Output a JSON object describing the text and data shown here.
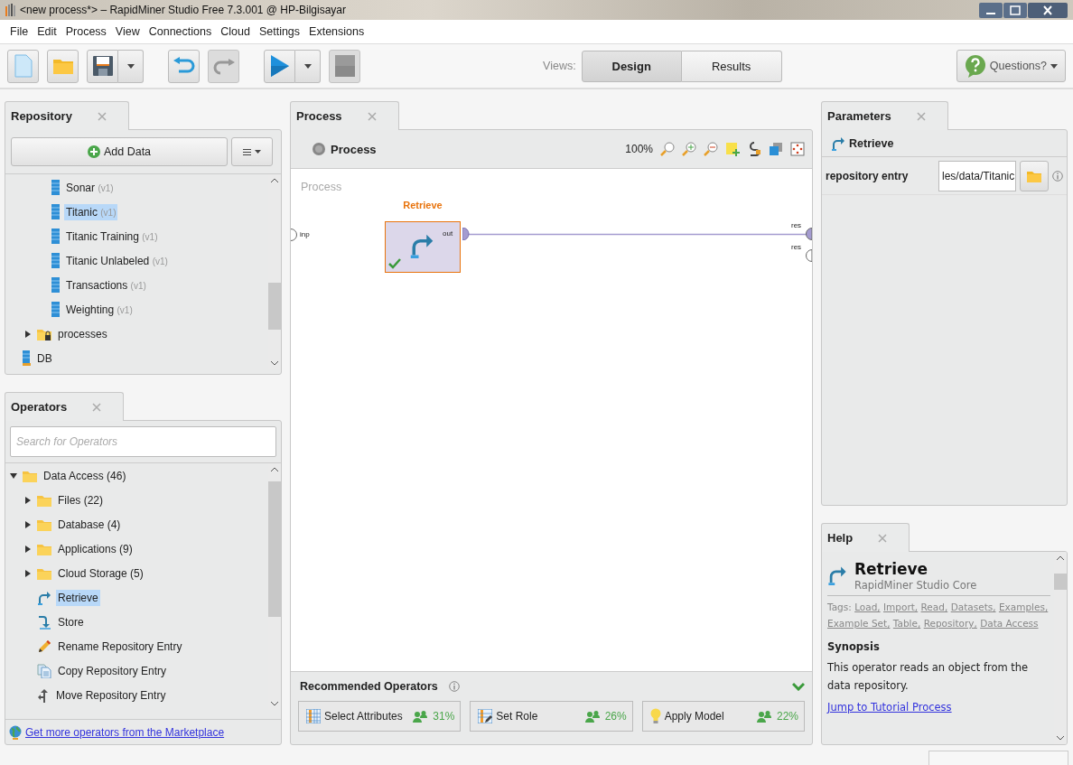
{
  "window": {
    "title": "<new process*> – RapidMiner Studio Free 7.3.001 @ HP-Bilgisayar"
  },
  "menu": [
    "File",
    "Edit",
    "Process",
    "View",
    "Connections",
    "Cloud",
    "Settings",
    "Extensions"
  ],
  "toolbar": {
    "buttons": [
      {
        "kind": "new",
        "disabled": false,
        "dropdown": false
      },
      {
        "kind": "open",
        "disabled": false,
        "dropdown": false
      },
      {
        "kind": "save",
        "disabled": false,
        "dropdown": true
      },
      {
        "kind": "undo",
        "disabled": false,
        "dropdown": false
      },
      {
        "kind": "redo",
        "disabled": true,
        "dropdown": false
      },
      {
        "kind": "run",
        "disabled": false,
        "dropdown": true
      },
      {
        "kind": "stop",
        "disabled": true,
        "dropdown": false
      }
    ],
    "views_label": "Views:",
    "views": [
      {
        "label": "Design",
        "selected": true
      },
      {
        "label": "Results",
        "selected": false
      }
    ],
    "help_button": "Questions?"
  },
  "repository": {
    "tab": "Repository",
    "add_data": "Add Data",
    "tree": [
      {
        "children": [
          {
            "children": [
              {
                "kind": "data",
                "label": "Sonar",
                "version": "(v1)",
                "selected": false
              },
              {
                "kind": "data",
                "label": "Titanic",
                "version": "(v1)",
                "selected": true
              },
              {
                "kind": "data",
                "label": "Titanic Training",
                "version": "(v1)",
                "selected": false
              },
              {
                "kind": "data",
                "label": "Titanic Unlabeled",
                "version": "(v1)",
                "selected": false
              },
              {
                "kind": "data",
                "label": "Transactions",
                "version": "(v1)",
                "selected": false
              },
              {
                "kind": "data",
                "label": "Weighting",
                "version": "(v1)",
                "selected": false
              }
            ]
          },
          {
            "kind": "locked-folder",
            "label": "processes",
            "expanded": false,
            "selected": false
          }
        ]
      },
      {
        "kind": "db",
        "label": "DB",
        "selected": false
      }
    ]
  },
  "operators": {
    "tab": "Operators",
    "search": {
      "placeholder": "Search for Operators"
    },
    "tree": [
      {
        "kind": "folder",
        "label": "Data Access (46)",
        "expanded": true,
        "selected": false,
        "children": [
          {
            "kind": "folder",
            "label": "Files (22)",
            "expanded": false,
            "selected": false
          },
          {
            "kind": "folder",
            "label": "Database (4)",
            "expanded": false,
            "selected": false
          },
          {
            "kind": "folder",
            "label": "Applications (9)",
            "expanded": false,
            "selected": false
          },
          {
            "kind": "folder",
            "label": "Cloud Storage (5)",
            "expanded": false,
            "selected": false
          },
          {
            "kind": "retrieve",
            "label": "Retrieve",
            "selected": true
          },
          {
            "kind": "store",
            "label": "Store",
            "selected": false
          },
          {
            "kind": "rename",
            "label": "Rename Repository Entry",
            "selected": false
          },
          {
            "kind": "copy",
            "label": "Copy Repository Entry",
            "selected": false
          },
          {
            "kind": "move",
            "label": "Move Repository Entry",
            "selected": false
          }
        ]
      }
    ],
    "marketplace_link": "Get more operators from the Marketplace"
  },
  "process": {
    "tab": "Process",
    "breadcrumb": "Process",
    "zoom": "100%",
    "canvas_label": "Process",
    "operator": {
      "name": "Retrieve",
      "output_port": "out",
      "status_ok": true
    },
    "input_port": "inp",
    "result_ports": [
      {
        "label": "res",
        "connected": true
      },
      {
        "label": "res",
        "connected": false
      }
    ],
    "recommended": {
      "title": "Recommended Operators",
      "items": [
        {
          "kind": "select-attributes",
          "label": "Select Attributes",
          "share": "31%"
        },
        {
          "kind": "set-role",
          "label": "Set Role",
          "share": "26%"
        },
        {
          "kind": "apply-model",
          "label": "Apply Model",
          "share": "22%"
        }
      ]
    }
  },
  "parameters": {
    "tab": "Parameters",
    "operator": "Retrieve",
    "rows": [
      {
        "label": "repository entry",
        "value": "les/data/Titanic"
      }
    ]
  },
  "help": {
    "tab": "Help",
    "title": "Retrieve",
    "subtitle": "RapidMiner Studio Core",
    "tags_label": "Tags:",
    "tags": [
      "Load,",
      "Import,",
      "Read,",
      "Datasets,",
      "Examples,",
      "Example Set,",
      "Table,",
      "Repository,",
      "Data Access"
    ],
    "synopsis_heading": "Synopsis",
    "synopsis": "This operator reads an object from the data repository.",
    "tutorial_link": "Jump to Tutorial Process"
  }
}
